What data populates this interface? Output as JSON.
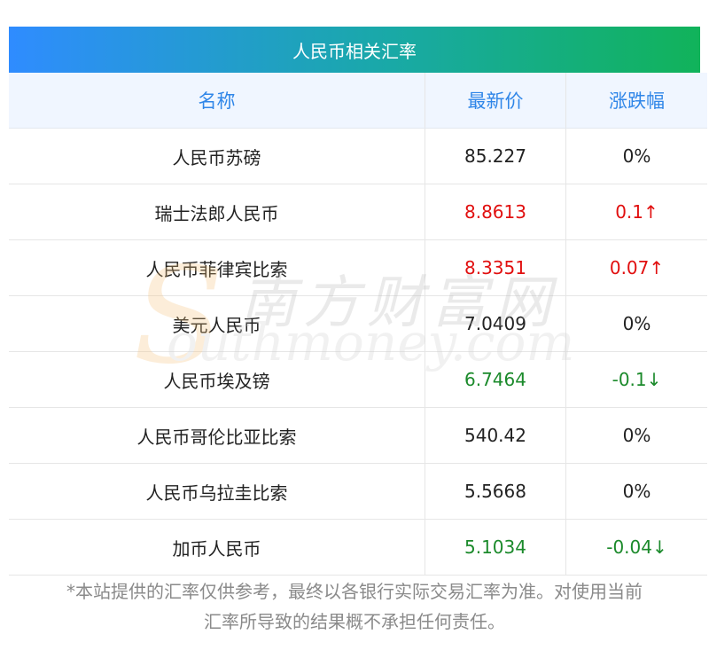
{
  "title": "人民币相关汇率",
  "headers": {
    "name": "名称",
    "price": "最新价",
    "change": "涨跌幅"
  },
  "rows": [
    {
      "name": "人民币苏磅",
      "price": "85.227",
      "change": "0%",
      "trend": "flat"
    },
    {
      "name": "瑞士法郎人民币",
      "price": "8.8613",
      "change": "0.1↑",
      "trend": "up"
    },
    {
      "name": "人民币菲律宾比索",
      "price": "8.3351",
      "change": "0.07↑",
      "trend": "up"
    },
    {
      "name": "美元人民币",
      "price": "7.0409",
      "change": "0%",
      "trend": "flat"
    },
    {
      "name": "人民币埃及镑",
      "price": "6.7464",
      "change": "-0.1↓",
      "trend": "down"
    },
    {
      "name": "人民币哥伦比亚比索",
      "price": "540.42",
      "change": "0%",
      "trend": "flat"
    },
    {
      "name": "人民币乌拉圭比索",
      "price": "5.5668",
      "change": "0%",
      "trend": "flat"
    },
    {
      "name": "加币人民币",
      "price": "5.1034",
      "change": "-0.04↓",
      "trend": "down"
    }
  ],
  "disclaimer_line1": "*本站提供的汇率仅供参考，最终以各银行实际交易汇率为准。对使用当前",
  "disclaimer_line2": "汇率所导致的结果概不承担任何责任。",
  "watermark": {
    "cn": "南方财富网",
    "en": "outhmoney.com",
    "s": "S"
  },
  "colors": {
    "up": "#e10f0f",
    "down": "#1b8a2b",
    "header_text": "#2f86e8"
  }
}
